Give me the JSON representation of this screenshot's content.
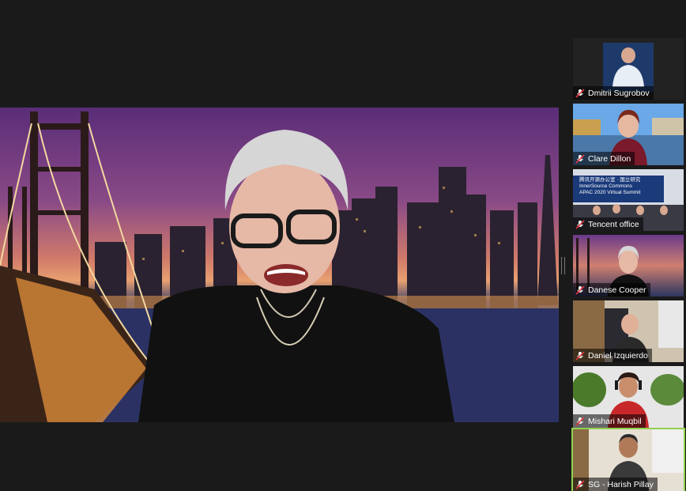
{
  "meeting": {
    "active_speaker": "Danese Cooper",
    "main_background": "San Francisco Bay Bridge at dusk"
  },
  "participants": [
    {
      "name": "Dmitrii Sugrobov",
      "muted": true
    },
    {
      "name": "Clare Dillon",
      "muted": true
    },
    {
      "name": "Tencent office",
      "muted": true,
      "banner_lines": [
        "腾讯开源办公室 · 国立研究",
        "InnerSource Commons",
        "APAC 2020 Virtual Summit"
      ]
    },
    {
      "name": "Danese Cooper",
      "muted": true
    },
    {
      "name": "Daniel Izquierdo",
      "muted": true
    },
    {
      "name": "Mishari Muqbil",
      "muted": true
    },
    {
      "name": "SG - Harish Pillay",
      "muted": true,
      "active": true
    }
  ],
  "colors": {
    "active_border": "#8fd14f",
    "mute_icon": "#e0393e",
    "window_bg": "#1a1a1a"
  }
}
